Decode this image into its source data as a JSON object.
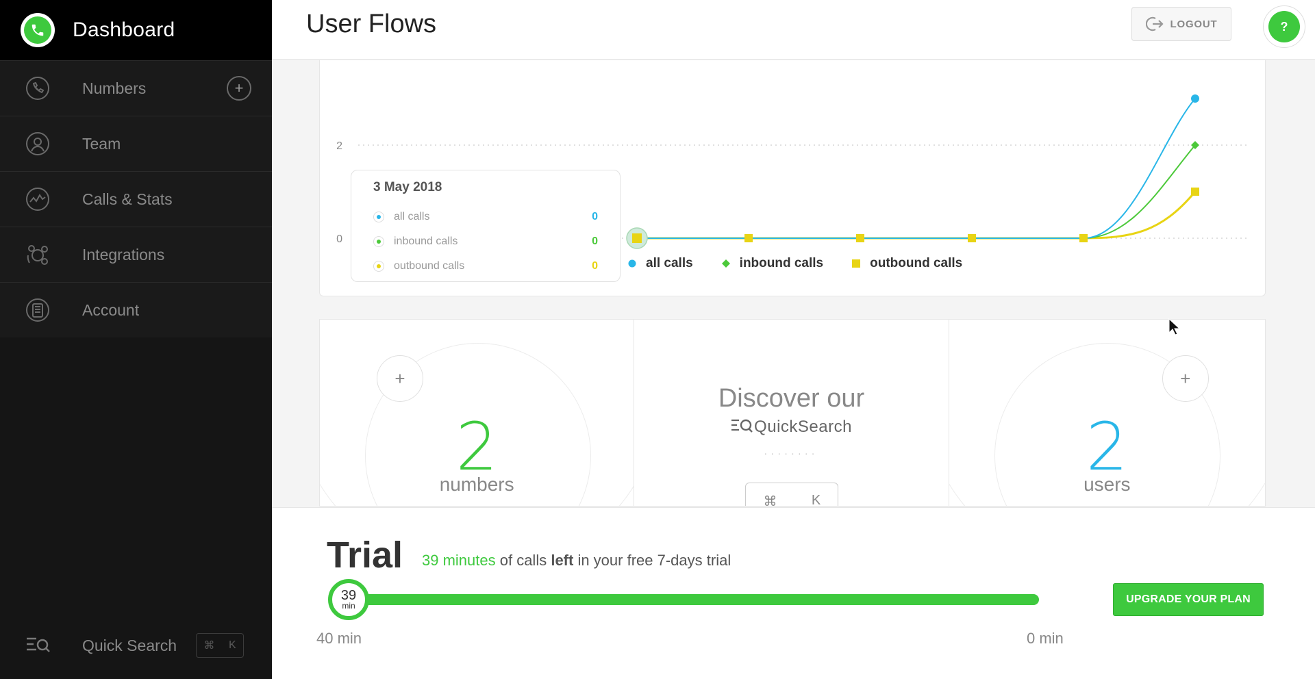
{
  "sidebar": {
    "brand_title": "Dashboard",
    "items": [
      {
        "label": "Numbers",
        "icon": "phone-icon",
        "has_add": true,
        "add_label": "+"
      },
      {
        "label": "Team",
        "icon": "user-icon"
      },
      {
        "label": "Calls & Stats",
        "icon": "stats-icon"
      },
      {
        "label": "Integrations",
        "icon": "integrations-icon"
      },
      {
        "label": "Account",
        "icon": "account-icon"
      }
    ],
    "quick_search": {
      "label": "Quick Search",
      "key1": "⌘",
      "key2": "K"
    }
  },
  "header": {
    "title": "User Flows",
    "logout_label": "LOGOUT",
    "help_label": "?"
  },
  "chart_data": {
    "type": "line",
    "y_ticks": [
      "2",
      "0"
    ],
    "ylim": [
      0,
      3
    ],
    "x_points": 6,
    "series": [
      {
        "name": "all calls",
        "color": "#29b6e8",
        "marker": "circle",
        "values": [
          0,
          0,
          0,
          0,
          0,
          3
        ]
      },
      {
        "name": "inbound calls",
        "color": "#4cc93a",
        "marker": "diamond",
        "values": [
          0,
          0,
          0,
          0,
          0,
          2
        ]
      },
      {
        "name": "outbound calls",
        "color": "#e8d414",
        "marker": "square",
        "values": [
          0,
          0,
          0,
          0,
          0,
          1
        ]
      }
    ],
    "tooltip": {
      "date": "3 May 2018",
      "rows": [
        {
          "label": "all calls",
          "value": "0",
          "color": "#29b6e8"
        },
        {
          "label": "inbound calls",
          "value": "0",
          "color": "#4cc93a"
        },
        {
          "label": "outbound calls",
          "value": "0",
          "color": "#e8d414"
        }
      ]
    }
  },
  "stats": {
    "numbers": {
      "value": "2",
      "label": "numbers",
      "color": "#3ec93e",
      "add_label": "+"
    },
    "discover": {
      "title": "Discover our",
      "brand": "QuickSearch",
      "key1": "⌘",
      "key2": "K"
    },
    "users": {
      "value": "2",
      "label": "users",
      "color": "#29b6e8",
      "add_label": "+"
    }
  },
  "trial": {
    "title": "Trial",
    "minutes_highlight": "39 minutes",
    "text_of_calls": " of calls ",
    "text_left": "left",
    "text_rest": " in your free 7-days trial",
    "knob_value": "39",
    "knob_unit": "min",
    "min_label": "40 min",
    "max_label": "0 min",
    "upgrade_label": "UPGRADE YOUR PLAN",
    "remaining_fraction": 0.975
  }
}
